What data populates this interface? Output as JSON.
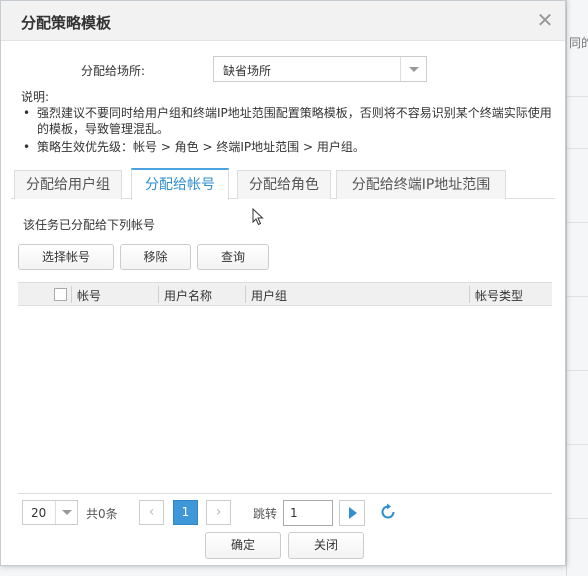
{
  "background": {
    "peek_text": "同的"
  },
  "dialog": {
    "title": "分配策略模板",
    "close_glyph": "✕"
  },
  "site": {
    "label": "分配给场所:",
    "value": "缺省场所"
  },
  "notes": {
    "title": "说明:",
    "items": [
      "强烈建议不要同时给用户组和终端IP地址范围配置策略模板，否则将不容易识别某个终端实际使用的模板，导致管理混乱。",
      "策略生效优先级：帐号 > 角色 > 终端IP地址范围 > 用户组。"
    ],
    "bullet": "•"
  },
  "tabs": [
    "分配给用户组",
    "分配给帐号",
    "分配给角色",
    "分配给终端IP地址范围"
  ],
  "active_tab": 1,
  "panel": {
    "assigned_text": "该任务已分配给下列帐号",
    "buttons": {
      "select": "选择帐号",
      "remove": "移除",
      "query": "查询"
    }
  },
  "table": {
    "columns": [
      "帐号",
      "用户名称",
      "用户组",
      "帐号类型"
    ],
    "rows": []
  },
  "pager": {
    "page_size": "20",
    "total": "共0条",
    "prev": "‹",
    "current_page": "1",
    "next": "›",
    "jump_label": "跳转",
    "jump_value": "1"
  },
  "footer": {
    "ok": "确定",
    "close": "关闭"
  },
  "colors": {
    "accent": "#3d97d8",
    "tab_active": "#2f8fd0"
  },
  "icons": [
    "close-icon",
    "chevron-down-icon",
    "refresh-icon",
    "go-arrow-icon",
    "mouse-cursor-icon"
  ]
}
